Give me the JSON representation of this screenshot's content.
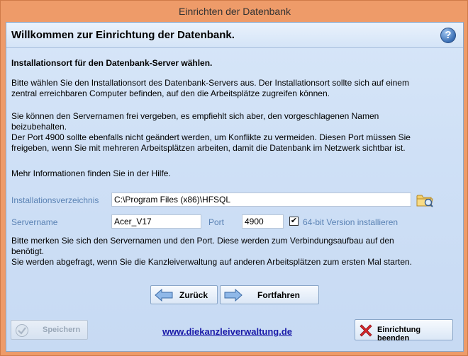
{
  "window": {
    "title": "Einrichten der Datenbank"
  },
  "header": {
    "title": "Willkommen zur Einrichtung der Datenbank.",
    "help_icon": "?"
  },
  "content": {
    "section_title": "Installationsort für den Datenbank-Server wählen.",
    "para1_line1": "Bitte wählen Sie den Installationsort des Datenbank-Servers aus. Der Installationsort sollte sich auf einem",
    "para1_line2": "zentral erreichbaren Computer befinden, auf den die Arbeitsplätze zugreifen können.",
    "para2_line1": "Sie können den Servernamen frei vergeben, es empfiehlt sich aber, den vorgeschlagenen Namen",
    "para2_line2": "beizubehalten.",
    "para2_line3": "Der Port 4900 sollte ebenfalls nicht geändert werden, um Konflikte zu vermeiden. Diesen Port müssen Sie",
    "para2_line4": "freigeben, wenn Sie mit mehreren Arbeitsplätzen arbeiten, damit die Datenbank im Netzwerk sichtbar ist.",
    "para3": "Mehr Informationen finden Sie in der Hilfe.",
    "para4_line1": "Bitte merken Sie sich den Servernamen und den Port. Diese werden zum Verbindungsaufbau auf den",
    "para4_line2": "benötigt.",
    "para4_line3": "Sie werden abgefragt, wenn Sie die Kanzleiverwaltung auf anderen Arbeitsplätzen zum ersten Mal starten."
  },
  "form": {
    "install_dir_label": "Installationsverzeichnis",
    "install_dir_value": "C:\\Program Files (x86)\\HFSQL",
    "servername_label": "Servername",
    "servername_value": "Acer_V17",
    "port_label": "Port",
    "port_value": "4900",
    "checkbox_label": "64-bit Version installieren",
    "checkbox_checked": true,
    "checkbox_mark": "✔"
  },
  "buttons": {
    "back": "Zurück",
    "next": "Fortfahren",
    "save": "Speichern",
    "cancel": "Einrichtung beenden"
  },
  "footer": {
    "link": "www.diekanzleiverwaltung.de"
  },
  "colors": {
    "frame": "#ee9b69",
    "client_bg": "#cfe0f6",
    "field_label": "#5a82b4",
    "link": "#1a1aa8",
    "cancel_icon": "#d9262b"
  }
}
